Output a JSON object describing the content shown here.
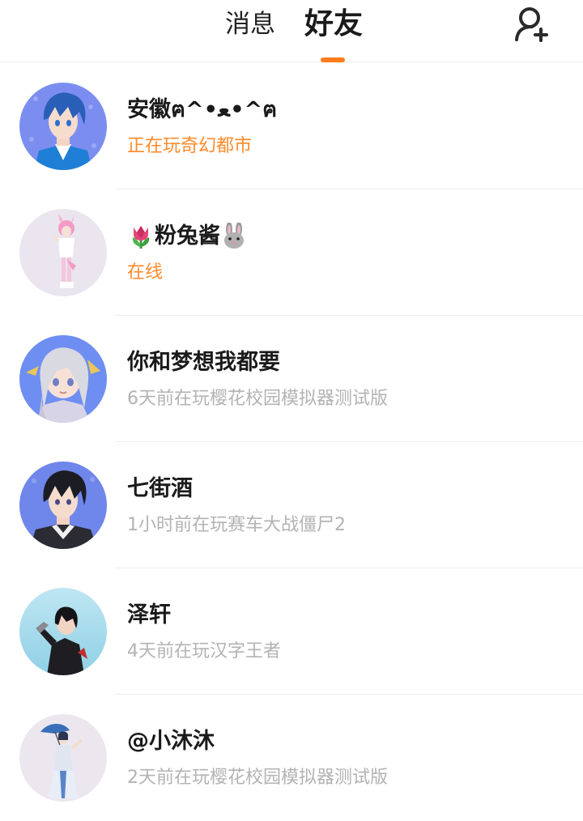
{
  "header": {
    "tabs": [
      {
        "label": "消息",
        "active": false
      },
      {
        "label": "好友",
        "active": true
      }
    ],
    "add_friend_icon": "add-user-icon",
    "accent_color": "#ff7a1a"
  },
  "friends": [
    {
      "name": "安徽ฅ^•ﻌ•^ฅ",
      "status": "正在玩奇幻都市",
      "online": true,
      "avatar": "avatar-blue-hair-boy"
    },
    {
      "name": "粉兔酱",
      "name_prefix_icon": "tulip-emoji-icon",
      "name_suffix_icon": "rabbit-emoji-icon",
      "status": "在线",
      "online": true,
      "avatar": "avatar-pink-bunny-girl"
    },
    {
      "name": "你和梦想我都要",
      "status": "6天前在玩樱花校园模拟器测试版",
      "online": false,
      "avatar": "avatar-silver-hair-girl"
    },
    {
      "name": "七街酒",
      "status": "1小时前在玩赛车大战僵尸2",
      "online": false,
      "avatar": "avatar-black-hair-boy"
    },
    {
      "name": "泽轩",
      "status": "4天前在玩汉字王者",
      "online": false,
      "avatar": "avatar-black-coat-boy"
    },
    {
      "name": "@小沐沐",
      "status": "2天前在玩樱花校园模拟器测试版",
      "online": false,
      "avatar": "avatar-umbrella-girl"
    }
  ],
  "colors": {
    "online_status": "#ff8a2a",
    "offline_status": "#b3b3b3",
    "divider": "#ececec"
  }
}
